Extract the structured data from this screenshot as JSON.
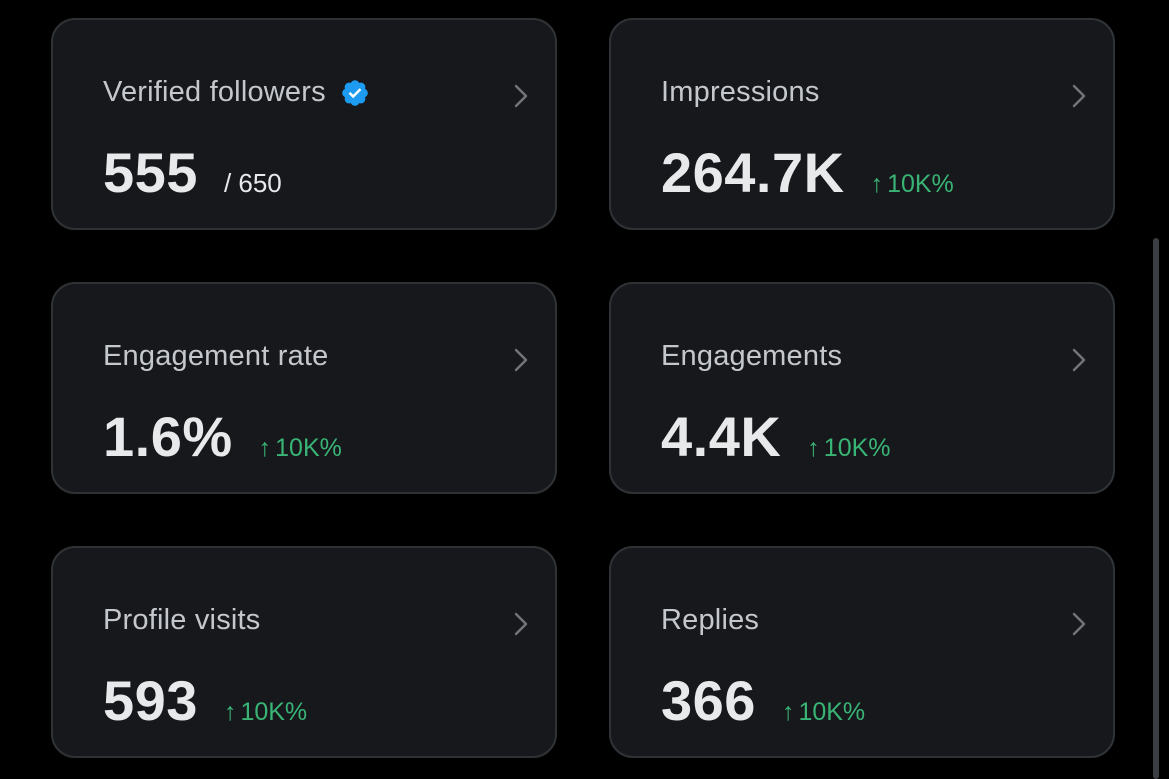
{
  "cards": [
    {
      "label": "Verified followers",
      "value": "555",
      "total": "/ 650",
      "verified_icon": "verified-badge-icon",
      "chevron_icon": "chevron-right-icon"
    },
    {
      "label": "Impressions",
      "value": "264.7K",
      "change_arrow": "↑",
      "change": "10K%",
      "chevron_icon": "chevron-right-icon"
    },
    {
      "label": "Engagement rate",
      "value": "1.6%",
      "change_arrow": "↑",
      "change": "10K%",
      "chevron_icon": "chevron-right-icon"
    },
    {
      "label": "Engagements",
      "value": "4.4K",
      "change_arrow": "↑",
      "change": "10K%",
      "chevron_icon": "chevron-right-icon"
    },
    {
      "label": "Profile visits",
      "value": "593",
      "change_arrow": "↑",
      "change": "10K%",
      "chevron_icon": "chevron-right-icon"
    },
    {
      "label": "Replies",
      "value": "366",
      "change_arrow": "↑",
      "change": "10K%",
      "chevron_icon": "chevron-right-icon"
    }
  ],
  "colors": {
    "background": "#000000",
    "card_background": "#16181c",
    "card_border": "#2f3336",
    "positive_change": "#39b475",
    "verified_badge": "#1d9bf0",
    "primary_text": "#e7e9ea",
    "secondary_text": "#c4c8cc"
  }
}
